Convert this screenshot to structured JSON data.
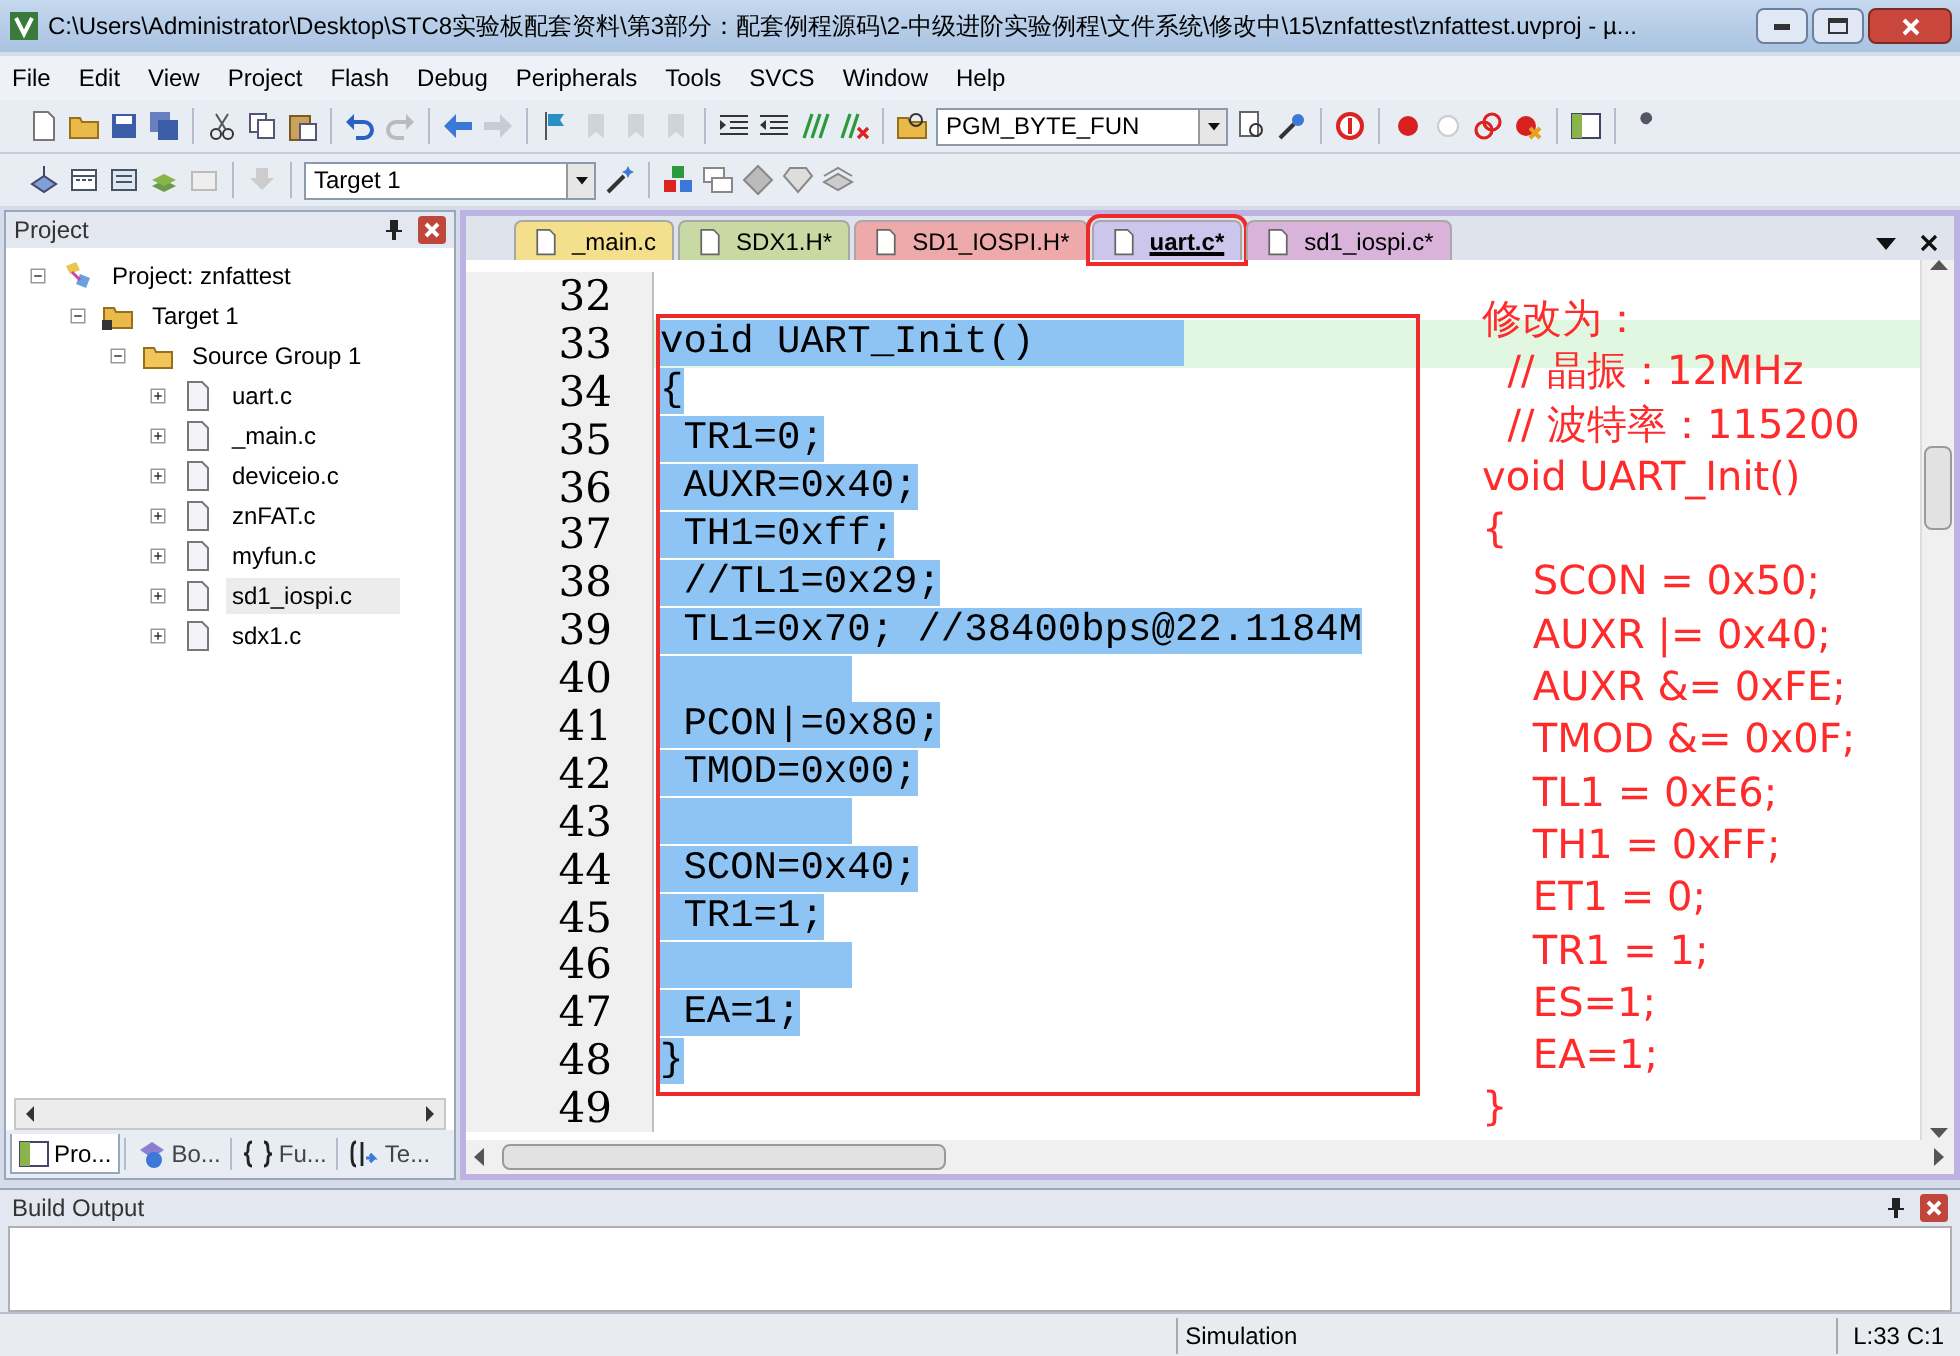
{
  "window": {
    "title": "C:\\Users\\Administrator\\Desktop\\STC8实验板配套资料\\第3部分：配套例程源码\\2-中级进阶实验例程\\文件系统\\修改中\\15\\znfattest\\znfattest.uvproj - µ..."
  },
  "menu": [
    "File",
    "Edit",
    "View",
    "Project",
    "Flash",
    "Debug",
    "Peripherals",
    "Tools",
    "SVCS",
    "Window",
    "Help"
  ],
  "toolbar": {
    "function_combo": "PGM_BYTE_FUN",
    "target_combo": "Target 1"
  },
  "project_panel": {
    "title": "Project",
    "tree": [
      {
        "label": "Project: znfattest",
        "kind": "project",
        "expanded": true,
        "selected": false,
        "children": [
          {
            "label": "Target 1",
            "kind": "target",
            "expanded": true,
            "selected": false,
            "children": [
              {
                "label": "Source Group 1",
                "kind": "group",
                "expanded": true,
                "selected": false,
                "children": [
                  {
                    "label": "uart.c",
                    "kind": "file",
                    "expanded": false,
                    "selected": false
                  },
                  {
                    "label": "_main.c",
                    "kind": "file",
                    "expanded": false,
                    "selected": false
                  },
                  {
                    "label": "deviceio.c",
                    "kind": "file",
                    "expanded": false,
                    "selected": false
                  },
                  {
                    "label": "znFAT.c",
                    "kind": "file",
                    "expanded": false,
                    "selected": false
                  },
                  {
                    "label": "myfun.c",
                    "kind": "file",
                    "expanded": false,
                    "selected": false
                  },
                  {
                    "label": "sd1_iospi.c",
                    "kind": "file",
                    "expanded": false,
                    "selected": true
                  },
                  {
                    "label": "sdx1.c",
                    "kind": "file",
                    "expanded": false,
                    "selected": false
                  }
                ]
              }
            ]
          }
        ]
      }
    ],
    "tabs": [
      {
        "label": "Pro...",
        "selected": true
      },
      {
        "label": "Bo...",
        "selected": false
      },
      {
        "label": "Fu...",
        "selected": false
      },
      {
        "label": "Te...",
        "selected": false
      }
    ]
  },
  "editor": {
    "tabs": [
      {
        "label": "_main.c",
        "selected": false,
        "color": "#f3df8c"
      },
      {
        "label": "SDX1.H*",
        "selected": false,
        "color": "#c9d9a4"
      },
      {
        "label": "SD1_IOSPI.H*",
        "selected": false,
        "color": "#eeaaaa"
      },
      {
        "label": "uart.c*",
        "selected": true,
        "color": "#cdc6ec"
      },
      {
        "label": "sd1_iospi.c*",
        "selected": false,
        "color": "#d9b3da"
      }
    ],
    "lines": [
      {
        "number": "32",
        "selected": false,
        "current": false
      },
      {
        "number": "33",
        "text": "void UART_Init()",
        "selected": true,
        "current": true
      },
      {
        "number": "34",
        "text": "{",
        "selected": true,
        "current": false
      },
      {
        "number": "35",
        "text": " TR1=0;",
        "selected": true,
        "current": false
      },
      {
        "number": "36",
        "text": " AUXR=0x40;",
        "selected": true,
        "current": false
      },
      {
        "number": "37",
        "text": " TH1=0xff;",
        "selected": true,
        "current": false
      },
      {
        "number": "38",
        "text": " //TL1=0x29;",
        "selected": true,
        "current": false
      },
      {
        "number": "39",
        "text": " TL1=0x70; //38400bps@22.1184M",
        "selected": true,
        "current": false
      },
      {
        "number": "40",
        "selected": true,
        "current": false
      },
      {
        "number": "41",
        "text": " PCON|=0x80;",
        "selected": true,
        "current": false
      },
      {
        "number": "42",
        "text": " TMOD=0x00;",
        "selected": true,
        "current": false
      },
      {
        "number": "43",
        "selected": true,
        "current": false
      },
      {
        "number": "44",
        "text": " SCON=0x40;",
        "selected": true,
        "current": false
      },
      {
        "number": "45",
        "text": " TR1=1;",
        "selected": true,
        "current": false
      },
      {
        "number": "46",
        "selected": true,
        "current": false
      },
      {
        "number": "47",
        "text": " EA=1;",
        "selected": true,
        "current": false
      },
      {
        "number": "48",
        "text": "}",
        "selected": true,
        "current": false
      },
      {
        "number": "49",
        "selected": false,
        "current": false
      }
    ],
    "annotation": [
      "修改为：",
      "  // 晶振：12MHz",
      "  // 波特率：115200",
      "void UART_Init()",
      "{",
      "    SCON = 0x50;",
      "    AUXR |= 0x40;",
      "    AUXR &= 0xFE;",
      "    TMOD &= 0x0F;",
      "    TL1 = 0xE6;",
      "    TH1 = 0xFF;",
      "    ET1 = 0;",
      "    TR1 = 1;",
      "    ES=1;",
      "    EA=1;",
      "}"
    ]
  },
  "build_output": {
    "title": "Build Output"
  },
  "status_bar": {
    "mode": "Simulation",
    "position": "L:33 C:1"
  }
}
